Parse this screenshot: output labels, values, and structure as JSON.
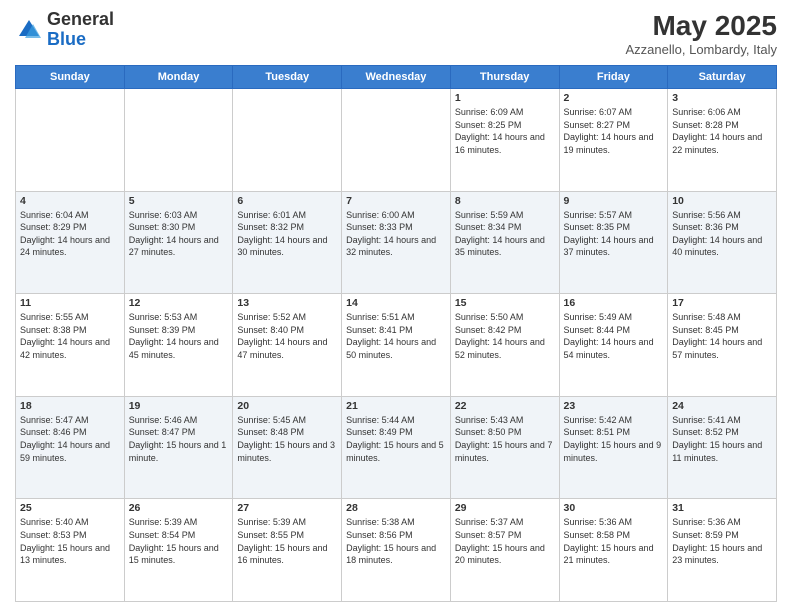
{
  "header": {
    "logo_general": "General",
    "logo_blue": "Blue",
    "month_title": "May 2025",
    "location": "Azzanello, Lombardy, Italy"
  },
  "days_of_week": [
    "Sunday",
    "Monday",
    "Tuesday",
    "Wednesday",
    "Thursday",
    "Friday",
    "Saturday"
  ],
  "weeks": [
    [
      {
        "day": "",
        "empty": true
      },
      {
        "day": "",
        "empty": true
      },
      {
        "day": "",
        "empty": true
      },
      {
        "day": "",
        "empty": true
      },
      {
        "day": "1",
        "sunrise": "6:09 AM",
        "sunset": "8:25 PM",
        "daylight": "14 hours and 16 minutes."
      },
      {
        "day": "2",
        "sunrise": "6:07 AM",
        "sunset": "8:27 PM",
        "daylight": "14 hours and 19 minutes."
      },
      {
        "day": "3",
        "sunrise": "6:06 AM",
        "sunset": "8:28 PM",
        "daylight": "14 hours and 22 minutes."
      }
    ],
    [
      {
        "day": "4",
        "sunrise": "6:04 AM",
        "sunset": "8:29 PM",
        "daylight": "14 hours and 24 minutes."
      },
      {
        "day": "5",
        "sunrise": "6:03 AM",
        "sunset": "8:30 PM",
        "daylight": "14 hours and 27 minutes."
      },
      {
        "day": "6",
        "sunrise": "6:01 AM",
        "sunset": "8:32 PM",
        "daylight": "14 hours and 30 minutes."
      },
      {
        "day": "7",
        "sunrise": "6:00 AM",
        "sunset": "8:33 PM",
        "daylight": "14 hours and 32 minutes."
      },
      {
        "day": "8",
        "sunrise": "5:59 AM",
        "sunset": "8:34 PM",
        "daylight": "14 hours and 35 minutes."
      },
      {
        "day": "9",
        "sunrise": "5:57 AM",
        "sunset": "8:35 PM",
        "daylight": "14 hours and 37 minutes."
      },
      {
        "day": "10",
        "sunrise": "5:56 AM",
        "sunset": "8:36 PM",
        "daylight": "14 hours and 40 minutes."
      }
    ],
    [
      {
        "day": "11",
        "sunrise": "5:55 AM",
        "sunset": "8:38 PM",
        "daylight": "14 hours and 42 minutes."
      },
      {
        "day": "12",
        "sunrise": "5:53 AM",
        "sunset": "8:39 PM",
        "daylight": "14 hours and 45 minutes."
      },
      {
        "day": "13",
        "sunrise": "5:52 AM",
        "sunset": "8:40 PM",
        "daylight": "14 hours and 47 minutes."
      },
      {
        "day": "14",
        "sunrise": "5:51 AM",
        "sunset": "8:41 PM",
        "daylight": "14 hours and 50 minutes."
      },
      {
        "day": "15",
        "sunrise": "5:50 AM",
        "sunset": "8:42 PM",
        "daylight": "14 hours and 52 minutes."
      },
      {
        "day": "16",
        "sunrise": "5:49 AM",
        "sunset": "8:44 PM",
        "daylight": "14 hours and 54 minutes."
      },
      {
        "day": "17",
        "sunrise": "5:48 AM",
        "sunset": "8:45 PM",
        "daylight": "14 hours and 57 minutes."
      }
    ],
    [
      {
        "day": "18",
        "sunrise": "5:47 AM",
        "sunset": "8:46 PM",
        "daylight": "14 hours and 59 minutes."
      },
      {
        "day": "19",
        "sunrise": "5:46 AM",
        "sunset": "8:47 PM",
        "daylight": "15 hours and 1 minute."
      },
      {
        "day": "20",
        "sunrise": "5:45 AM",
        "sunset": "8:48 PM",
        "daylight": "15 hours and 3 minutes."
      },
      {
        "day": "21",
        "sunrise": "5:44 AM",
        "sunset": "8:49 PM",
        "daylight": "15 hours and 5 minutes."
      },
      {
        "day": "22",
        "sunrise": "5:43 AM",
        "sunset": "8:50 PM",
        "daylight": "15 hours and 7 minutes."
      },
      {
        "day": "23",
        "sunrise": "5:42 AM",
        "sunset": "8:51 PM",
        "daylight": "15 hours and 9 minutes."
      },
      {
        "day": "24",
        "sunrise": "5:41 AM",
        "sunset": "8:52 PM",
        "daylight": "15 hours and 11 minutes."
      }
    ],
    [
      {
        "day": "25",
        "sunrise": "5:40 AM",
        "sunset": "8:53 PM",
        "daylight": "15 hours and 13 minutes."
      },
      {
        "day": "26",
        "sunrise": "5:39 AM",
        "sunset": "8:54 PM",
        "daylight": "15 hours and 15 minutes."
      },
      {
        "day": "27",
        "sunrise": "5:39 AM",
        "sunset": "8:55 PM",
        "daylight": "15 hours and 16 minutes."
      },
      {
        "day": "28",
        "sunrise": "5:38 AM",
        "sunset": "8:56 PM",
        "daylight": "15 hours and 18 minutes."
      },
      {
        "day": "29",
        "sunrise": "5:37 AM",
        "sunset": "8:57 PM",
        "daylight": "15 hours and 20 minutes."
      },
      {
        "day": "30",
        "sunrise": "5:36 AM",
        "sunset": "8:58 PM",
        "daylight": "15 hours and 21 minutes."
      },
      {
        "day": "31",
        "sunrise": "5:36 AM",
        "sunset": "8:59 PM",
        "daylight": "15 hours and 23 minutes."
      }
    ]
  ],
  "labels": {
    "sunrise": "Sunrise:",
    "sunset": "Sunset:",
    "daylight": "Daylight hours"
  }
}
